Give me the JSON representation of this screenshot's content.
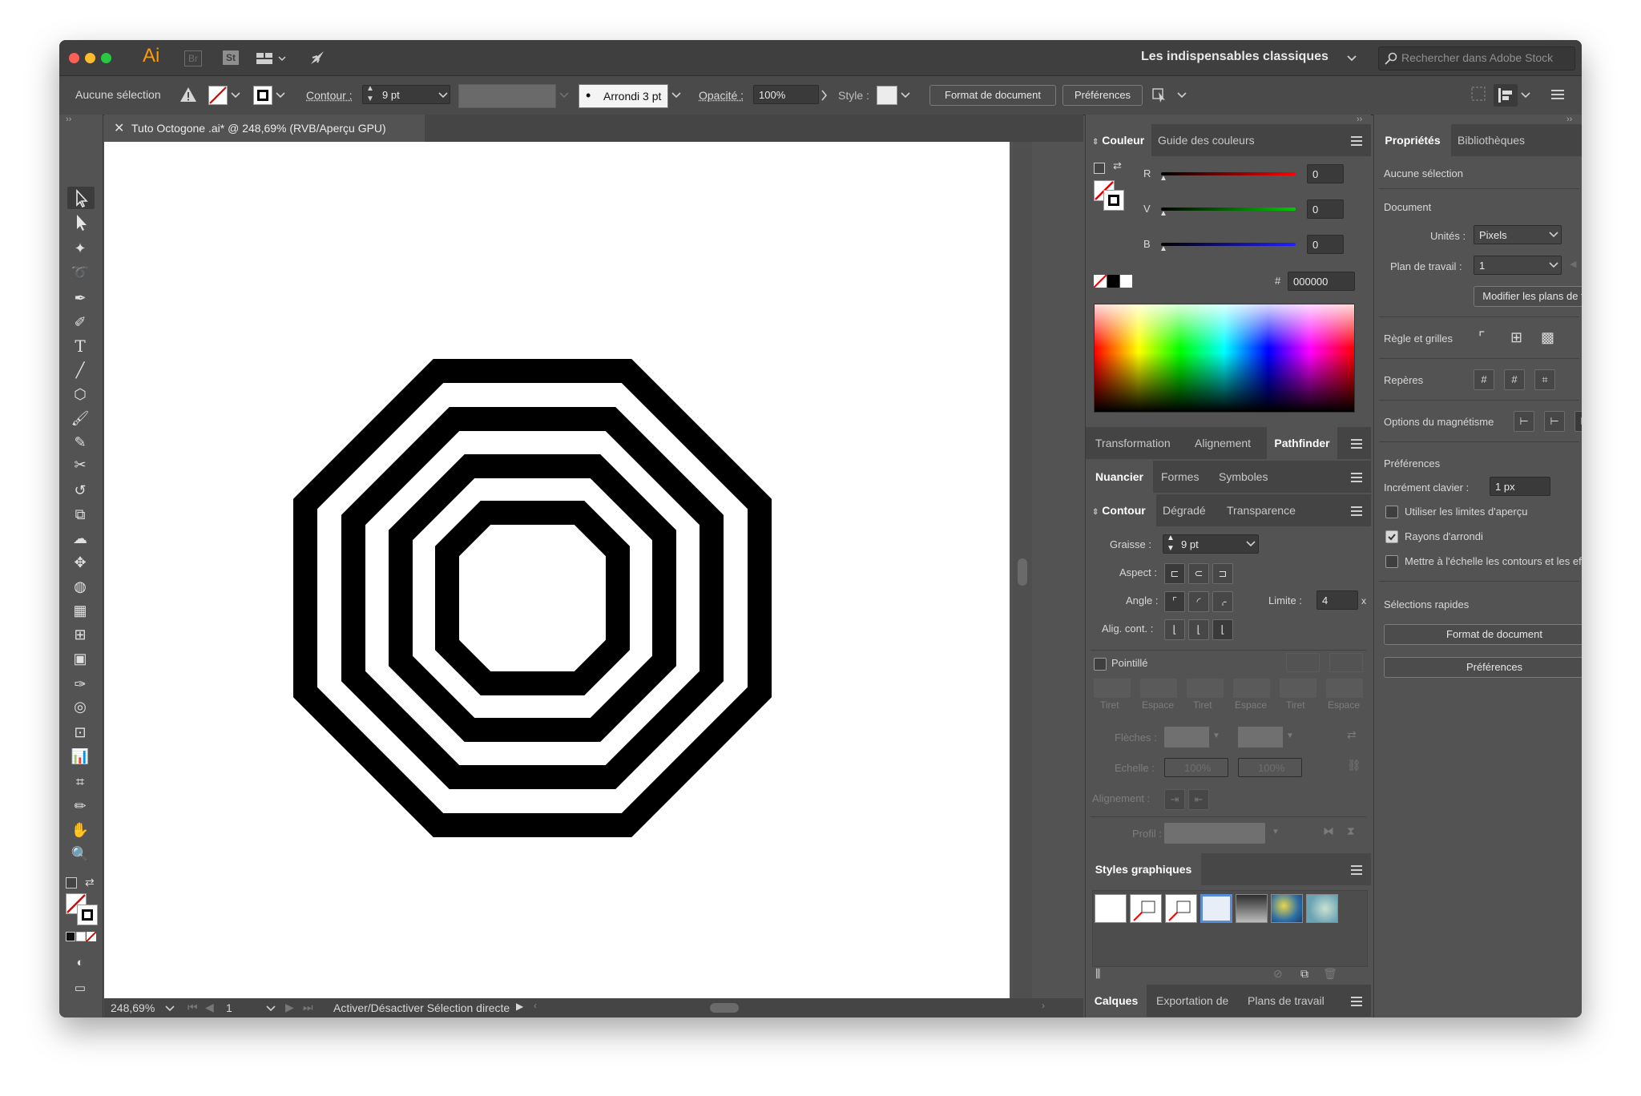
{
  "app": {
    "logo": "Ai",
    "br": "Br",
    "st": "St",
    "workspace": "Les indispensables classiques",
    "search_placeholder": "Rechercher dans Adobe Stock"
  },
  "control": {
    "selection": "Aucune sélection",
    "contour_label": "Contour :",
    "contour_value": "9 pt",
    "brush_label": "Arrondi 3 pt",
    "opacity_label": "Opacité :",
    "opacity_value": "100%",
    "style_label": "Style :",
    "format_button": "Format de document",
    "prefs_button": "Préférences"
  },
  "document": {
    "tab_title": "Tuto Octogone .ai* @ 248,69% (RVB/Aperçu GPU)"
  },
  "status": {
    "zoom": "248,69%",
    "artboard": "1",
    "message": "Activer/Désactiver Sélection directe"
  },
  "couleur": {
    "tabs": [
      "Couleur",
      "Guide des couleurs"
    ],
    "r_label": "R",
    "r_value": "0",
    "g_label": "V",
    "g_value": "0",
    "b_label": "B",
    "b_value": "0",
    "hash": "#",
    "hex": "000000"
  },
  "transform_tabs": [
    "Transformation",
    "Alignement",
    "Pathfinder"
  ],
  "nuancier_tabs": [
    "Nuancier",
    "Formes",
    "Symboles"
  ],
  "contour_tabs": [
    "Contour",
    "Dégradé",
    "Transparence"
  ],
  "contour": {
    "graisse_label": "Graisse :",
    "graisse_value": "9 pt",
    "aspect_label": "Aspect :",
    "angle_label": "Angle :",
    "limite_label": "Limite :",
    "limite_value": "4",
    "limite_x": "x",
    "align_label": "Alig. cont. :",
    "pointille_label": "Pointillé",
    "dash_labels": [
      "Tiret",
      "Espace",
      "Tiret",
      "Espace",
      "Tiret",
      "Espace"
    ],
    "fleches_label": "Flèches :",
    "echelle_label": "Echelle :",
    "echelle_value1": "100%",
    "echelle_value2": "100%",
    "alignement_label": "Alignement :",
    "profil_label": "Profil :"
  },
  "styles": {
    "title": "Styles graphiques"
  },
  "calques_tabs": [
    "Calques",
    "Exportation de",
    "Plans de travail"
  ],
  "proprietes": {
    "tabs": [
      "Propriétés",
      "Bibliothèques"
    ],
    "no_selection": "Aucune sélection",
    "document": "Document",
    "unites_label": "Unités :",
    "unites_value": "Pixels",
    "plan_label": "Plan de travail :",
    "plan_value": "1",
    "modifier_button": "Modifier les plans de travail",
    "regle": "Règle et grilles",
    "reperes": "Repères",
    "magnetisme": "Options du magnétisme",
    "preferences": "Préférences",
    "increment_label": "Incrément clavier :",
    "increment_value": "1 px",
    "chk1": "Utiliser les limites d'aperçu",
    "chk2": "Rayons d'arrondi",
    "chk3": "Mettre à l'échelle les contours et les effets",
    "rapides": "Sélections rapides",
    "format_button": "Format de document",
    "prefs_button": "Préférences"
  }
}
